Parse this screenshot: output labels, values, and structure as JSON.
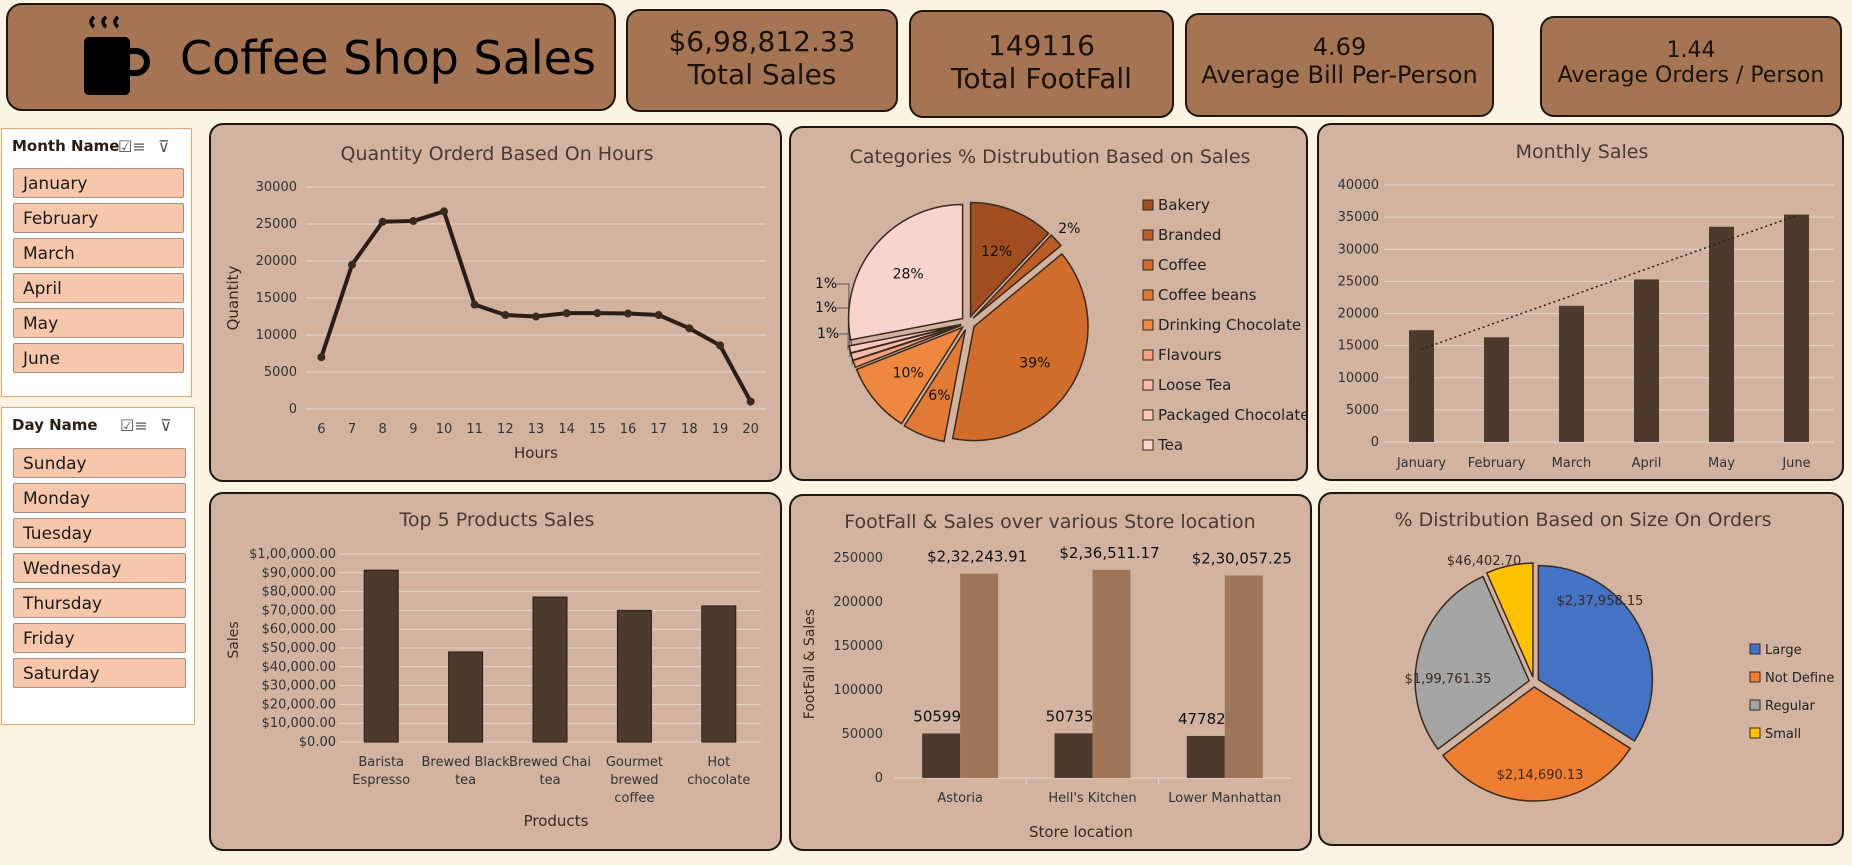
{
  "title": "Coffee Shop Sales",
  "kpis": [
    {
      "value": "$6,98,812.33",
      "label": "Total Sales"
    },
    {
      "value": "149116",
      "label": "Total FootFall"
    },
    {
      "value": "4.69",
      "label": "Average Bill Per-Person"
    },
    {
      "value": "1.44",
      "label": "Average Orders / Person"
    }
  ],
  "slicers": {
    "month": {
      "header": "Month Name",
      "items": [
        "January",
        "February",
        "March",
        "April",
        "May",
        "June"
      ]
    },
    "day": {
      "header": "Day Name",
      "items": [
        "Sunday",
        "Monday",
        "Tuesday",
        "Wednesday",
        "Thursday",
        "Friday",
        "Saturday"
      ]
    }
  },
  "icons": {
    "cup": "coffee-cup-icon",
    "multiselect": "multiselect-icon",
    "clear_filter": "clear-filter-icon"
  },
  "colors": {
    "panel": "#d2b3a0",
    "kpi": "#a57452",
    "bar_dark": "#4e3a2a",
    "bar_light": "#a0755a"
  },
  "chart_data": [
    {
      "id": "hours",
      "type": "line",
      "title": "Quantity Orderd Based On Hours",
      "xlabel": "Hours",
      "ylabel": "Quantity",
      "x": [
        6,
        7,
        8,
        9,
        10,
        11,
        12,
        13,
        14,
        15,
        16,
        17,
        18,
        19,
        20
      ],
      "values": [
        7000,
        19500,
        25300,
        25400,
        26700,
        14100,
        12700,
        12500,
        12950,
        12950,
        12900,
        12700,
        10900,
        8600,
        1000
      ],
      "ylim": [
        0,
        30000
      ],
      "yticks": [
        "0",
        "5000",
        "10000",
        "15000",
        "20000",
        "25000",
        "30000"
      ],
      "grid": true
    },
    {
      "id": "categories",
      "type": "pie",
      "title": "Categories % Distrubution Based on Sales",
      "legend_position": "right",
      "slices": [
        {
          "name": "Bakery",
          "value": 12,
          "label": "12%",
          "color": "#a04e22"
        },
        {
          "name": "Branded",
          "value": 2,
          "label": "2%",
          "color": "#bc5d28"
        },
        {
          "name": "Coffee",
          "value": 39,
          "label": "39%",
          "color": "#d06d2d"
        },
        {
          "name": "Coffee beans",
          "value": 6,
          "label": "6%",
          "color": "#e07a35"
        },
        {
          "name": "Drinking Chocolate",
          "value": 10,
          "label": "10%",
          "color": "#ee8840"
        },
        {
          "name": "Flavours",
          "value": 1,
          "label": "1%",
          "color": "#f2a07e"
        },
        {
          "name": "Loose Tea",
          "value": 1,
          "label": "1%",
          "color": "#f6bbaa"
        },
        {
          "name": "Packaged Chocolate",
          "value": 1,
          "label": "1%",
          "color": "#f8cabd"
        },
        {
          "name": "Tea",
          "value": 28,
          "label": "28%",
          "color": "#f7d5cc"
        }
      ]
    },
    {
      "id": "monthly",
      "type": "bar",
      "title": "Monthly Sales",
      "categories": [
        "January",
        "February",
        "March",
        "April",
        "May",
        "June"
      ],
      "values": [
        17400,
        16300,
        21200,
        25300,
        33500,
        35400
      ],
      "ylim": [
        0,
        40000
      ],
      "yticks": [
        "0",
        "5000",
        "10000",
        "15000",
        "20000",
        "25000",
        "30000",
        "35000",
        "40000"
      ],
      "trendline": "linear",
      "grid": true
    },
    {
      "id": "products",
      "type": "bar",
      "title": "Top 5 Products Sales",
      "xlabel": "Products",
      "ylabel": "Sales",
      "categories": [
        [
          "Barista",
          "Espresso"
        ],
        [
          "Brewed Black",
          "tea"
        ],
        [
          "Brewed Chai",
          "tea"
        ],
        [
          "Gourmet",
          "brewed",
          "coffee"
        ],
        [
          "Hot",
          "chocolate"
        ]
      ],
      "values": [
        91400,
        47900,
        77100,
        70000,
        72400
      ],
      "ylim": [
        0,
        100000
      ],
      "yticks": [
        "$0.00",
        "$10,000.00",
        "$20,000.00",
        "$30,000.00",
        "$40,000.00",
        "$50,000.00",
        "$60,000.00",
        "$70,000.00",
        "$80,000.00",
        "$90,000.00",
        "$1,00,000.00"
      ],
      "grid": true
    },
    {
      "id": "stores",
      "type": "bar",
      "title": "FootFall & Sales over various Store location",
      "xlabel": "Store location",
      "ylabel": "FootFall & Sales",
      "categories": [
        "Astoria",
        "Hell's Kitchen",
        "Lower Manhattan"
      ],
      "series": [
        {
          "values": [
            50599,
            50735,
            47782
          ],
          "labels": [
            "50599",
            "50735",
            "47782"
          ],
          "color": "#4e3a2a"
        },
        {
          "values": [
            232243.91,
            236511.17,
            230057.25
          ],
          "labels": [
            "$2,32,243.91",
            "$2,36,511.17",
            "$2,30,057.25"
          ],
          "color": "#a0755a"
        }
      ],
      "ylim": [
        0,
        250000
      ],
      "yticks": [
        "0",
        "50000",
        "100000",
        "150000",
        "200000",
        "250000"
      ]
    },
    {
      "id": "sizes",
      "type": "pie",
      "title": "% Distribution Based on Size On Orders",
      "legend_position": "right",
      "slices": [
        {
          "name": "Large",
          "value": 237958.15,
          "label": "$2,37,958.15",
          "color": "#4472c4"
        },
        {
          "name": "Not Define",
          "value": 214690.13,
          "label": "$2,14,690.13",
          "color": "#ed7d31"
        },
        {
          "name": "Regular",
          "value": 199761.35,
          "label": "$1,99,761.35",
          "color": "#a5a5a5"
        },
        {
          "name": "Small",
          "value": 46402.7,
          "label": "$46,402.70",
          "color": "#ffc000"
        }
      ]
    }
  ]
}
